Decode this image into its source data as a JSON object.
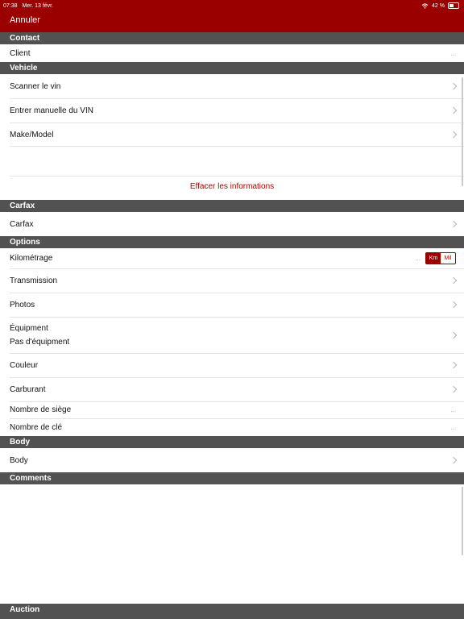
{
  "status_bar": {
    "time": "07:38",
    "date": "Mer. 13 févr.",
    "battery": "42 %"
  },
  "nav": {
    "cancel_label": "Annuler"
  },
  "sections": {
    "contact": "Contact",
    "vehicle": "Vehicle",
    "carfax": "Carfax",
    "options": "Options",
    "body": "Body",
    "comments": "Comments",
    "auction": "Auction"
  },
  "rows": {
    "client": "Client",
    "scan_vin": "Scanner le vin",
    "manual_vin": "Entrer manuelle du VIN",
    "make_model": "Make/Model",
    "carfax": "Carfax",
    "mileage": "Kilométrage",
    "transmission": "Transmission",
    "photos": "Photos",
    "equipment": "Équipment",
    "equipment_value": "Pas d'équipment",
    "color": "Couleur",
    "fuel": "Carburant",
    "seats": "Nombre de siège",
    "keys": "Nombre de clé",
    "body": "Body"
  },
  "placeholders": {
    "ellipsis": "..."
  },
  "unit_toggle": {
    "km": "Km",
    "mil": "Mil",
    "selected": "Km"
  },
  "clear_info_label": "Effacer les informations",
  "colors": {
    "brand": "#9b0000",
    "section_header": "#525252"
  }
}
